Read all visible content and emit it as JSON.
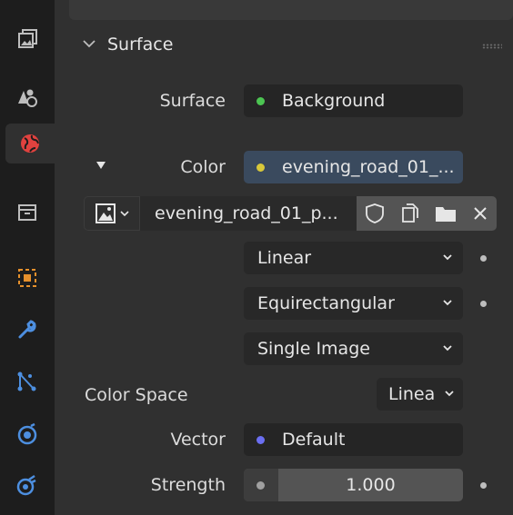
{
  "panel": {
    "title": "Surface"
  },
  "surface_row": {
    "label": "Surface",
    "value": "Background",
    "socket_color": "#4cc552"
  },
  "color_row": {
    "label": "Color",
    "value": "evening_road_01_...",
    "socket_color": "#d8c83a"
  },
  "image_row": {
    "image_name": "evening_road_01_p..."
  },
  "interpolation": {
    "value": "Linear"
  },
  "projection": {
    "value": "Equirectangular"
  },
  "source": {
    "value": "Single Image"
  },
  "color_space": {
    "label": "Color Space",
    "value": "Linea"
  },
  "vector_row": {
    "label": "Vector",
    "value": "Default",
    "socket_color": "#6b6ff2"
  },
  "strength_row": {
    "label": "Strength",
    "value": "1.000",
    "socket_color": "#a0a0a0"
  },
  "sidebar_tabs": [
    "render-layers-icon",
    "scene-icon",
    "world-icon",
    "collection-icon",
    "object-icon",
    "modifier-icon",
    "particles-icon",
    "physics-icon",
    "constraints-icon"
  ]
}
